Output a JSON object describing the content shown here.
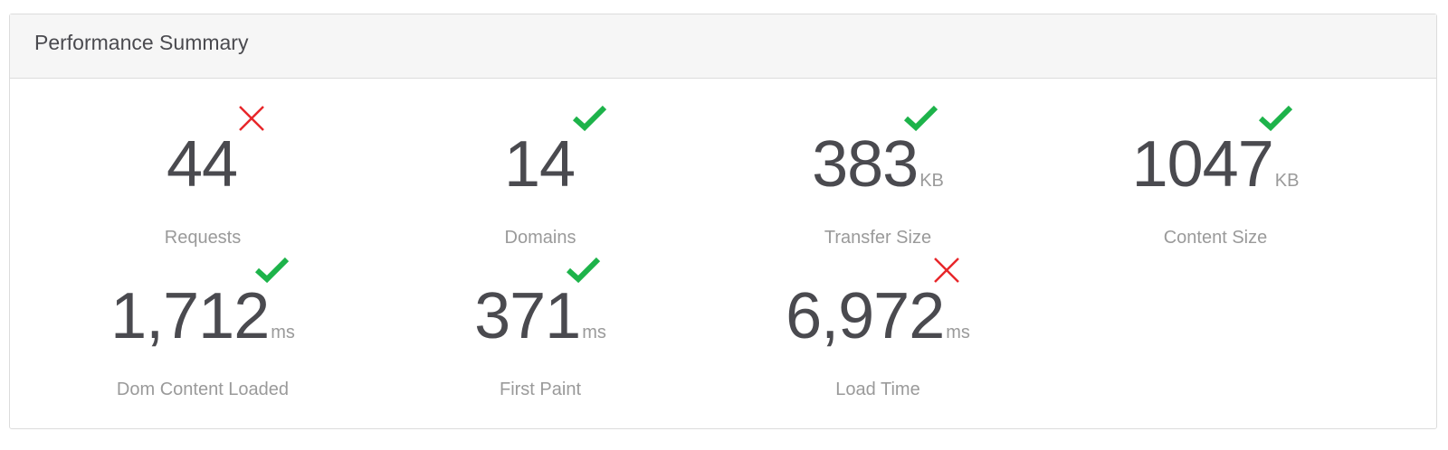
{
  "panel": {
    "title": "Performance Summary"
  },
  "colors": {
    "pass": "#1db34a",
    "fail": "#e8262a"
  },
  "metrics": [
    {
      "value": "44",
      "unit": "",
      "label": "Requests",
      "status": "fail",
      "status_icon": "cross-icon"
    },
    {
      "value": "14",
      "unit": "",
      "label": "Domains",
      "status": "pass",
      "status_icon": "check-icon"
    },
    {
      "value": "383",
      "unit": "KB",
      "label": "Transfer Size",
      "status": "pass",
      "status_icon": "check-icon"
    },
    {
      "value": "1047",
      "unit": "KB",
      "label": "Content Size",
      "status": "pass",
      "status_icon": "check-icon"
    },
    {
      "value": "1,712",
      "unit": "ms",
      "label": "Dom Content Loaded",
      "status": "pass",
      "status_icon": "check-icon"
    },
    {
      "value": "371",
      "unit": "ms",
      "label": "First Paint",
      "status": "pass",
      "status_icon": "check-icon"
    },
    {
      "value": "6,972",
      "unit": "ms",
      "label": "Load Time",
      "status": "fail",
      "status_icon": "cross-icon"
    }
  ]
}
